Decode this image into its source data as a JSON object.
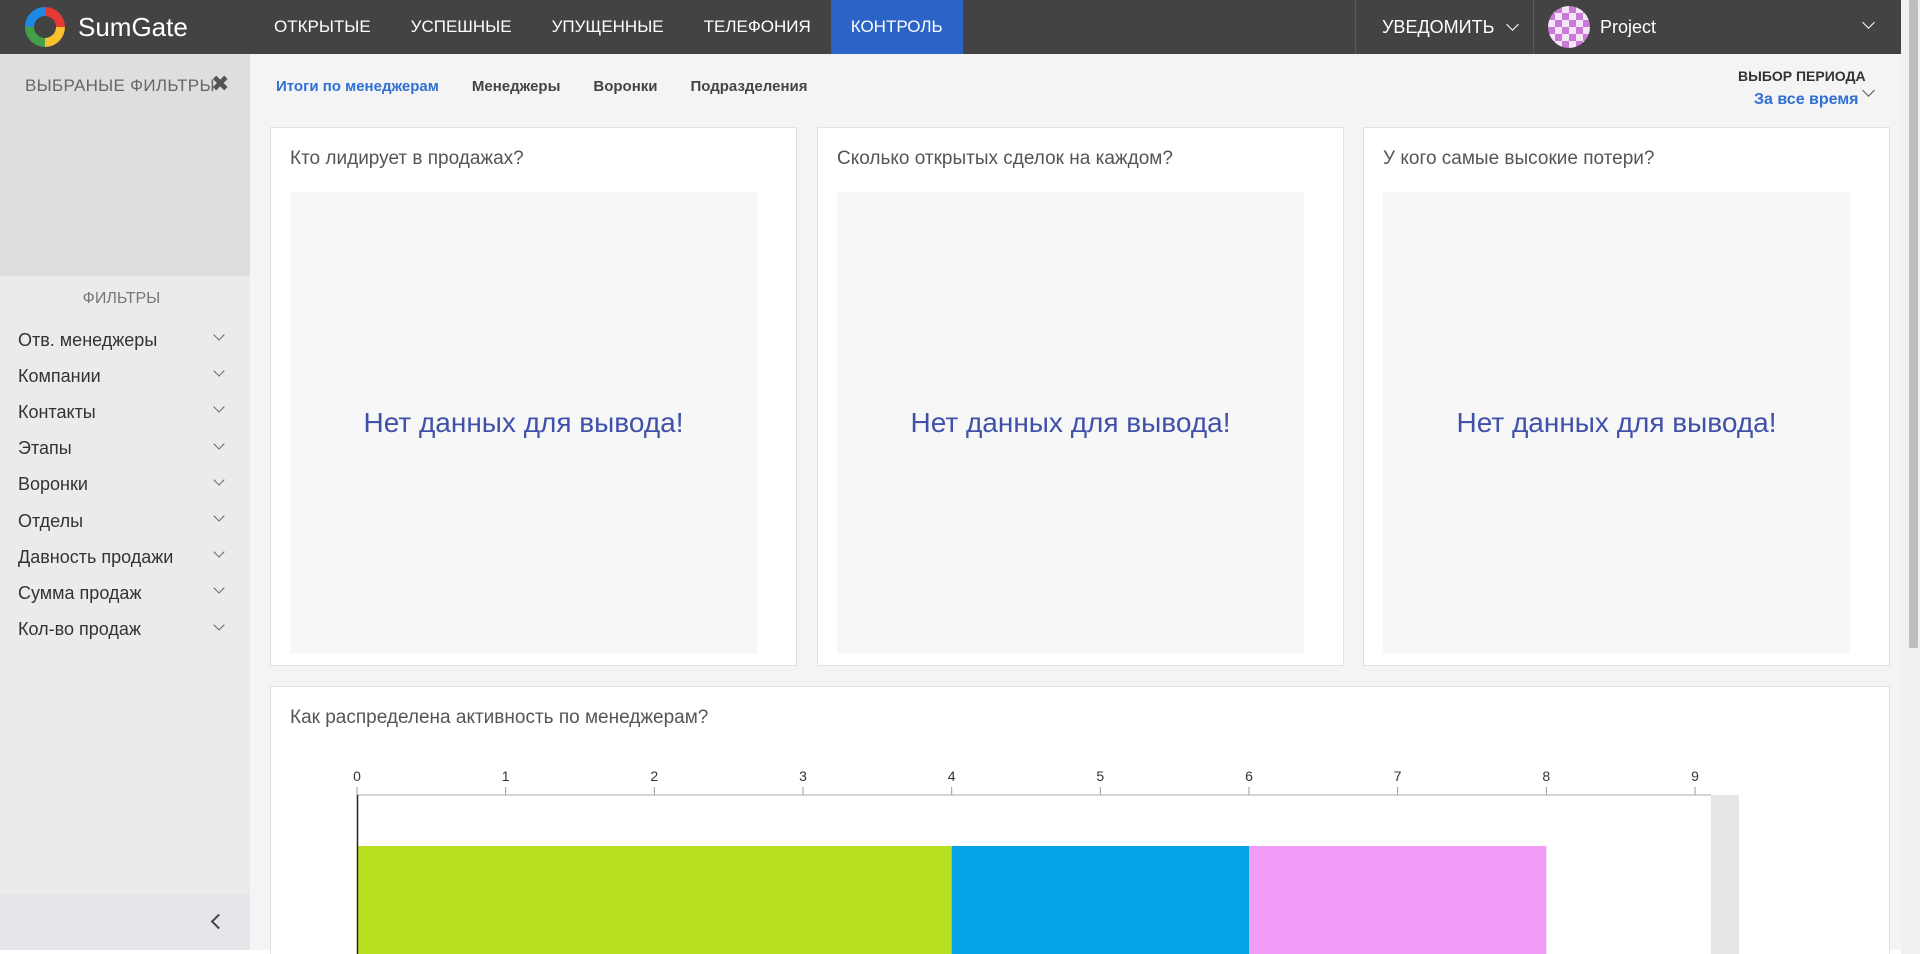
{
  "topbar": {
    "brand": "SumGate",
    "nav": [
      {
        "label": "ОТКРЫТЫЕ"
      },
      {
        "label": "УСПЕШНЫЕ"
      },
      {
        "label": "УПУЩЕННЫЕ"
      },
      {
        "label": "ТЕЛЕФОНИЯ"
      },
      {
        "label": "КОНТРОЛЬ",
        "active": true
      }
    ],
    "notify_label": "УВЕДОМИТЬ",
    "project_label": "Project"
  },
  "sidebar": {
    "selected_title": "ВЫБРАНЫЕ ФИЛЬТРЫ",
    "close_glyph": "✖",
    "filters_title": "ФИЛЬТРЫ",
    "filters": [
      {
        "label": "Отв. менеджеры"
      },
      {
        "label": "Компании"
      },
      {
        "label": "Контакты"
      },
      {
        "label": "Этапы"
      },
      {
        "label": "Воронки"
      },
      {
        "label": "Отделы"
      },
      {
        "label": "Давность продажи"
      },
      {
        "label": "Сумма продаж"
      },
      {
        "label": "Кол-во продаж"
      }
    ]
  },
  "main": {
    "tabs": [
      {
        "label": "Итоги по менеджерам",
        "active": true
      },
      {
        "label": "Менеджеры"
      },
      {
        "label": "Воронки"
      },
      {
        "label": "Подразделения"
      }
    ],
    "period": {
      "title": "ВЫБОР ПЕРИОДА",
      "value": "За все время"
    },
    "cards": [
      {
        "title": "Кто лидирует в продажах?",
        "empty_text": "Нет данных для вывода!"
      },
      {
        "title": "Сколько открытых сделок на каждом?",
        "empty_text": "Нет данных для вывода!"
      },
      {
        "title": "У кого самые высокие потери?",
        "empty_text": "Нет данных для вывода!"
      }
    ],
    "activity_title": "Как распределена активность по менеджерам?"
  },
  "colors": {
    "topbar_bg": "#434343",
    "nav_active": "#2c63c6",
    "accent_blue": "#2f6fd6",
    "empty_text": "#3f51a8"
  },
  "chart_data": {
    "type": "bar",
    "orientation": "horizontal-stacked",
    "xlim": [
      0,
      9
    ],
    "ticks": [
      "0",
      "1",
      "2",
      "3",
      "4",
      "5",
      "6",
      "7",
      "8",
      "9"
    ],
    "segments": [
      {
        "start": 0,
        "end": 4,
        "color": "#b8e020"
      },
      {
        "start": 4,
        "end": 6,
        "color": "#04a3e6"
      },
      {
        "start": 6,
        "end": 8,
        "color": "#f19cf7"
      }
    ]
  }
}
